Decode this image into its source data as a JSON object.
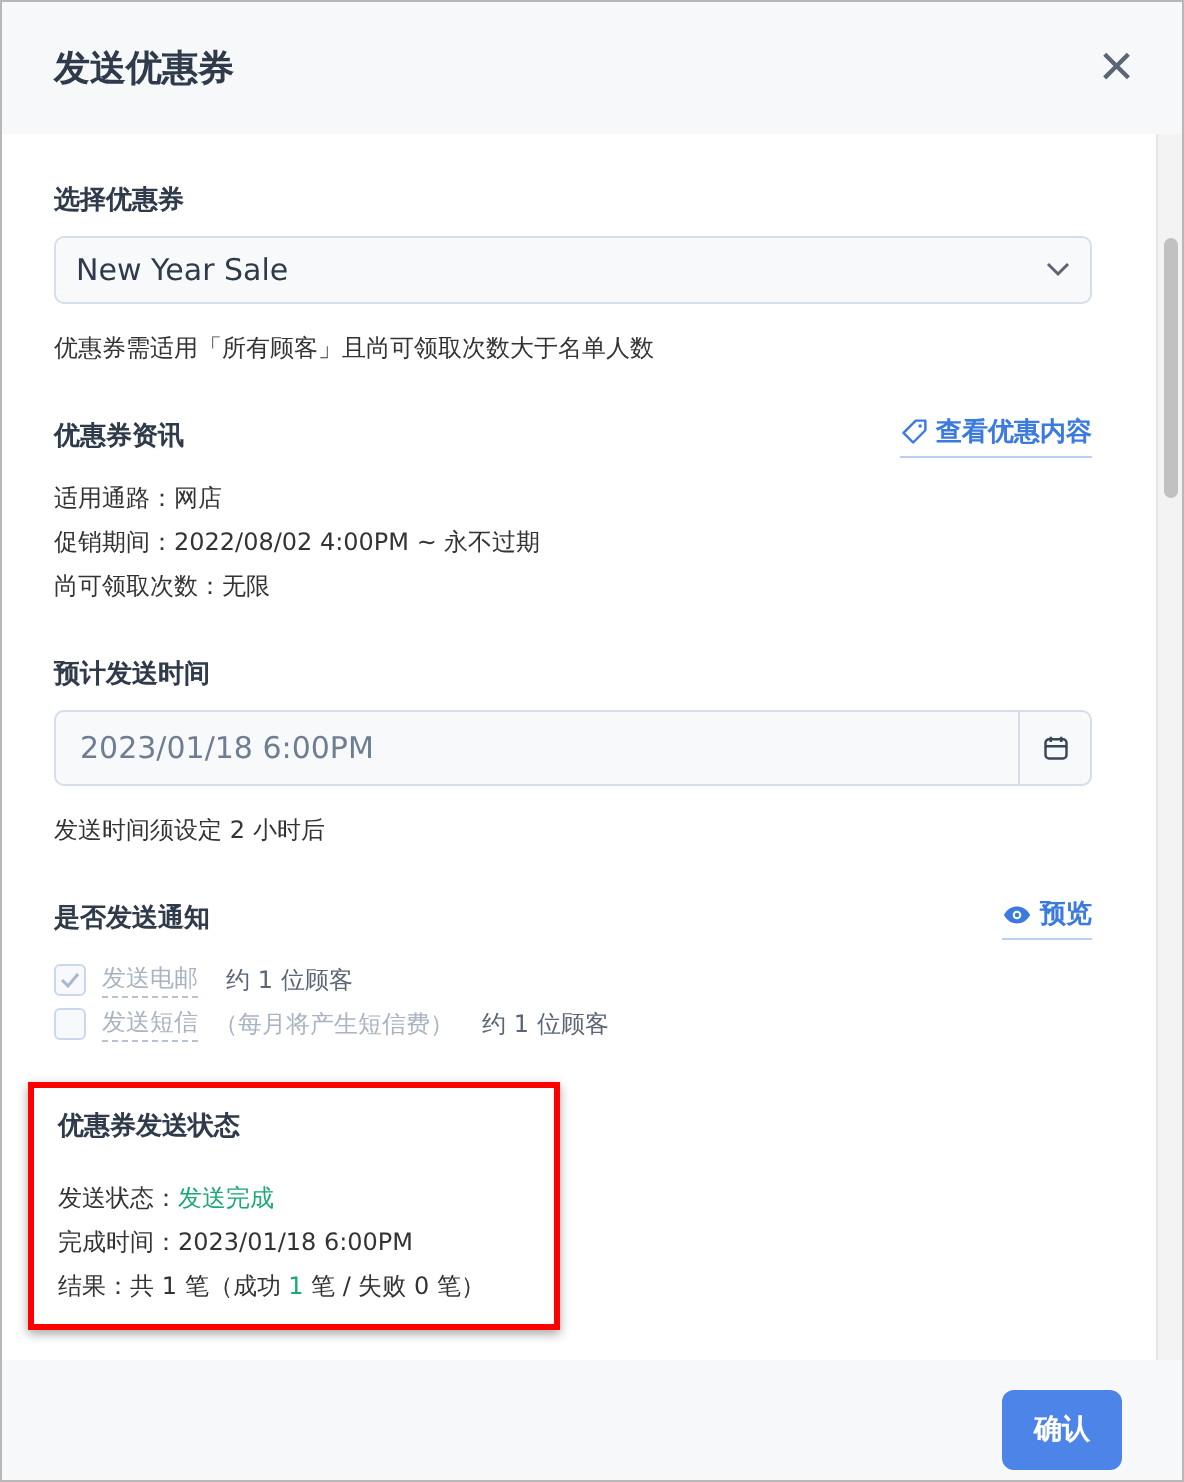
{
  "dialog": {
    "title": "发送优惠券",
    "close": "×"
  },
  "coupon_select": {
    "label": "选择优惠券",
    "value": "New Year Sale",
    "hint": "优惠券需适用「所有顾客」且尚可领取次数大于名单人数"
  },
  "coupon_info": {
    "title": "优惠券资讯",
    "link": "查看优惠内容",
    "lines": [
      "适用通路：网店",
      "促销期间：2022/08/02 4:00PM ~ 永不过期",
      "尚可领取次数：无限"
    ]
  },
  "send_time": {
    "label": "预计发送时间",
    "value": "2023/01/18 6:00PM",
    "hint": "发送时间须设定 2 小时后"
  },
  "notify": {
    "title": "是否发送通知",
    "link": "预览",
    "options": [
      {
        "label": "发送电邮",
        "count": "约 1 位顾客",
        "checked": true,
        "disabled": true
      },
      {
        "label": "发送短信",
        "note": "（每月将产生短信费）",
        "count": "约 1 位顾客",
        "checked": false,
        "disabled": true
      }
    ]
  },
  "send_status": {
    "title": "优惠券发送状态",
    "highlighted": true,
    "status_label": "发送状态：",
    "status_value": "发送完成",
    "time": "完成时间：2023/01/18 6:00PM",
    "result": {
      "prefix": "结果：共 1 笔（成功 ",
      "success": "1",
      "suffix": " 笔 / 失败 0 笔）"
    }
  },
  "footer": {
    "confirm": "确认"
  }
}
